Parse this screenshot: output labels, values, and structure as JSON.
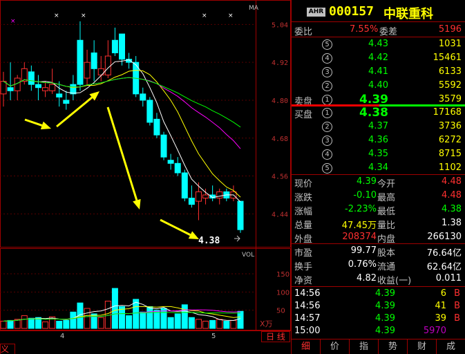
{
  "chart": {
    "ma_label": "MA",
    "vol_label": "VOL",
    "vol_unit": "X万",
    "price_axis": [
      "5.04",
      "4.92",
      "4.80",
      "4.68",
      "4.56",
      "4.44"
    ],
    "vol_axis": [
      "150",
      "100",
      "50"
    ],
    "date_labels": [
      "4",
      "5"
    ],
    "last_price_label": "4.38",
    "period_button": "日 线",
    "left_tab": "义"
  },
  "chart_data": {
    "type": "candlestick",
    "ylim": [
      4.34,
      5.1
    ],
    "candles": [
      {
        "o": 4.82,
        "c": 4.86,
        "h": 4.89,
        "l": 4.78,
        "v": 20
      },
      {
        "o": 4.84,
        "c": 4.83,
        "h": 4.92,
        "l": 4.8,
        "v": 22
      },
      {
        "o": 4.83,
        "c": 4.87,
        "h": 4.88,
        "l": 4.8,
        "v": 25
      },
      {
        "o": 4.86,
        "c": 4.9,
        "h": 4.92,
        "l": 4.85,
        "v": 35
      },
      {
        "o": 4.89,
        "c": 4.85,
        "h": 4.91,
        "l": 4.83,
        "v": 28
      },
      {
        "o": 4.85,
        "c": 4.84,
        "h": 4.88,
        "l": 4.8,
        "v": 30
      },
      {
        "o": 4.83,
        "c": 4.84,
        "h": 4.86,
        "l": 4.81,
        "v": 18
      },
      {
        "o": 4.83,
        "c": 4.85,
        "h": 4.9,
        "l": 4.82,
        "v": 32
      },
      {
        "o": 4.82,
        "c": 4.81,
        "h": 4.86,
        "l": 4.78,
        "v": 20
      },
      {
        "o": 4.8,
        "c": 4.79,
        "h": 4.83,
        "l": 4.77,
        "v": 22
      },
      {
        "o": 4.85,
        "c": 4.82,
        "h": 4.88,
        "l": 4.8,
        "v": 45
      },
      {
        "o": 4.99,
        "c": 4.85,
        "h": 5.05,
        "l": 4.83,
        "v": 70
      },
      {
        "o": 4.87,
        "c": 4.92,
        "h": 4.96,
        "l": 4.85,
        "v": 55
      },
      {
        "o": 4.95,
        "c": 4.9,
        "h": 4.99,
        "l": 4.86,
        "v": 40
      },
      {
        "o": 4.88,
        "c": 4.9,
        "h": 4.94,
        "l": 4.86,
        "v": 30
      },
      {
        "o": 4.88,
        "c": 4.94,
        "h": 4.99,
        "l": 4.87,
        "v": 75
      },
      {
        "o": 4.99,
        "c": 4.95,
        "h": 5.03,
        "l": 4.94,
        "v": 110
      },
      {
        "o": 5.01,
        "c": 4.93,
        "h": 5.01,
        "l": 4.91,
        "v": 60
      },
      {
        "o": 4.93,
        "c": 4.92,
        "h": 4.95,
        "l": 4.9,
        "v": 35
      },
      {
        "o": 4.92,
        "c": 4.82,
        "h": 4.94,
        "l": 4.81,
        "v": 80
      },
      {
        "o": 4.82,
        "c": 4.8,
        "h": 4.84,
        "l": 4.78,
        "v": 45
      },
      {
        "o": 4.8,
        "c": 4.73,
        "h": 4.81,
        "l": 4.72,
        "v": 60
      },
      {
        "o": 4.74,
        "c": 4.69,
        "h": 4.76,
        "l": 4.68,
        "v": 50
      },
      {
        "o": 4.69,
        "c": 4.62,
        "h": 4.7,
        "l": 4.61,
        "v": 55
      },
      {
        "o": 4.61,
        "c": 4.6,
        "h": 4.63,
        "l": 4.58,
        "v": 30
      },
      {
        "o": 4.6,
        "c": 4.57,
        "h": 4.62,
        "l": 4.56,
        "v": 40
      },
      {
        "o": 4.57,
        "c": 4.49,
        "h": 4.58,
        "l": 4.48,
        "v": 65
      },
      {
        "o": 4.49,
        "c": 4.47,
        "h": 4.53,
        "l": 4.46,
        "v": 30
      },
      {
        "o": 4.48,
        "c": 4.51,
        "h": 4.54,
        "l": 4.42,
        "v": 25
      },
      {
        "o": 4.49,
        "c": 4.5,
        "h": 4.52,
        "l": 4.47,
        "v": 20
      },
      {
        "o": 4.5,
        "c": 4.49,
        "h": 4.53,
        "l": 4.48,
        "v": 22
      },
      {
        "o": 4.49,
        "c": 4.51,
        "h": 4.52,
        "l": 4.47,
        "v": 25
      },
      {
        "o": 4.51,
        "c": 4.49,
        "h": 4.52,
        "l": 4.48,
        "v": 20
      },
      {
        "o": 4.49,
        "c": 4.51,
        "h": 4.53,
        "l": 4.48,
        "v": 22
      },
      {
        "o": 4.48,
        "c": 4.39,
        "h": 4.48,
        "l": 4.38,
        "v": 47
      }
    ],
    "vol_ylim": [
      0,
      190
    ]
  },
  "quote": {
    "badge": "AHR",
    "code": "000157",
    "name": "中联重科",
    "wei_bi_label": "委比",
    "wei_bi": "7.55%",
    "wei_cha_label": "委差",
    "wei_cha": "5196",
    "sell_label": "卖盘",
    "buy_label": "买盘",
    "asks": [
      {
        "n": "⑤",
        "p": "4.43",
        "v": "1031"
      },
      {
        "n": "④",
        "p": "4.42",
        "v": "15461"
      },
      {
        "n": "③",
        "p": "4.41",
        "v": "6133"
      },
      {
        "n": "②",
        "p": "4.40",
        "v": "5592"
      },
      {
        "n": "①",
        "p": "4.39",
        "v": "3579"
      }
    ],
    "bids": [
      {
        "n": "①",
        "p": "4.38",
        "v": "17168"
      },
      {
        "n": "②",
        "p": "4.37",
        "v": "3736"
      },
      {
        "n": "③",
        "p": "4.36",
        "v": "6272"
      },
      {
        "n": "④",
        "p": "4.35",
        "v": "8715"
      },
      {
        "n": "⑤",
        "p": "4.34",
        "v": "1102"
      }
    ],
    "stats": [
      {
        "l1": "现价",
        "v1": "4.39",
        "l2": "今开",
        "v2": "4.48"
      },
      {
        "l1": "涨跌",
        "v1": "-0.10",
        "l2": "最高",
        "v2": "4.48"
      },
      {
        "l1": "涨幅",
        "v1": "-2.23%",
        "l2": "最低",
        "v2": "4.38"
      },
      {
        "l1": "总量",
        "v1": "47.45万",
        "l2": "量比",
        "v2": "1.38"
      },
      {
        "l1": "外盘",
        "v1": "208374",
        "l2": "内盘",
        "v2": "266130"
      }
    ],
    "fund": [
      {
        "l1": "市盈",
        "v1": "99.77",
        "l2": "股本",
        "v2": "76.64亿"
      },
      {
        "l1": "换手",
        "v1": "0.76%",
        "l2": "流通",
        "v2": "62.64亿"
      },
      {
        "l1": "净资",
        "v1": "4.82",
        "l2": "收益(一)",
        "v2": "0.011"
      }
    ],
    "ticks": [
      {
        "t": "14:56",
        "p": "4.39",
        "v": "6",
        "s": "B"
      },
      {
        "t": "14:56",
        "p": "4.39",
        "v": "41",
        "s": "B"
      },
      {
        "t": "14:57",
        "p": "4.39",
        "v": "39",
        "s": "B"
      },
      {
        "t": "15:00",
        "p": "4.39",
        "v": "5970",
        "s": ""
      }
    ],
    "tabs": [
      "细",
      "价",
      "指",
      "势",
      "财",
      "成"
    ]
  }
}
